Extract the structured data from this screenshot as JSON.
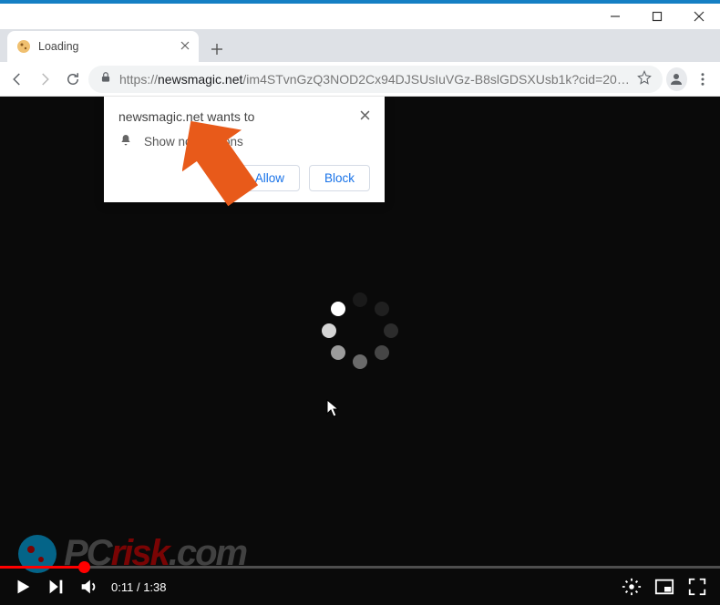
{
  "window": {
    "minimize": "–",
    "maximize": "□",
    "close": "×"
  },
  "tab": {
    "title": "Loading",
    "close": "×",
    "newtab": "+"
  },
  "omnibox": {
    "scheme": "https://",
    "host": "newsmagic.net",
    "rest": "/im4STvnGzQ3NOD2Cx94DJSUsIuVGz-B8slGDSXUsb1k?cid=20…"
  },
  "popup": {
    "title": "newsmagic.net wants to",
    "row": "Show notifications",
    "allow": "Allow",
    "block": "Block",
    "close": "×"
  },
  "video": {
    "time_current": "0:11",
    "time_sep": " / ",
    "time_total": "1:38",
    "progress_pct": 11.8
  },
  "watermark": {
    "a": "PC",
    "b": "risk",
    "c": ".com"
  },
  "spinner_dots": [
    {
      "angle": 0,
      "color": "#2c2c2c"
    },
    {
      "angle": 45,
      "color": "#464646"
    },
    {
      "angle": 90,
      "color": "#6a6a6a"
    },
    {
      "angle": 135,
      "color": "#9c9c9c"
    },
    {
      "angle": 180,
      "color": "#d5d5d5"
    },
    {
      "angle": 225,
      "color": "#ffffff"
    },
    {
      "angle": 270,
      "color": "#1a1a1a"
    },
    {
      "angle": 315,
      "color": "#202020"
    }
  ]
}
